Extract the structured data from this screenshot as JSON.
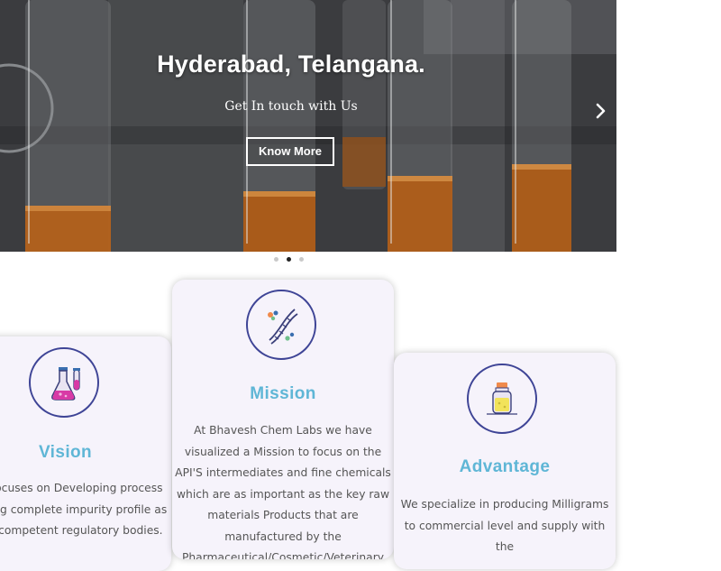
{
  "hero": {
    "title": "Hyderabad, Telangana.",
    "subtitle": "Get In touch with Us",
    "button_label": "Know More",
    "next_icon": "chevron-right-icon",
    "slide_count": 3,
    "active_slide": 2
  },
  "cards": {
    "vision": {
      "icon": "flask-icon",
      "title": "Vision",
      "text_lines": [
        "nly focuses on Developing process",
        "oviding complete impurity profile as",
        "d by competent regulatory bodies."
      ]
    },
    "mission": {
      "icon": "dna-icon",
      "title": "Mission",
      "text": "At Bhavesh Chem Labs we have visualized a Mission to focus on the API'S intermediates and fine chemicals which are as important as the key raw materials Products that are manufactured by the Pharmaceutical/Cosmetic/Veterinary"
    },
    "advantage": {
      "icon": "medicine-jar-icon",
      "title": "Advantage",
      "text": "We specialize in producing Milligrams to commercial level and supply with the"
    }
  },
  "colors": {
    "accent": "#5fb6d6",
    "circle_border": "#3e4496",
    "card_bg": "#f6f3fb",
    "hero_bg": "#3a3b3d"
  }
}
